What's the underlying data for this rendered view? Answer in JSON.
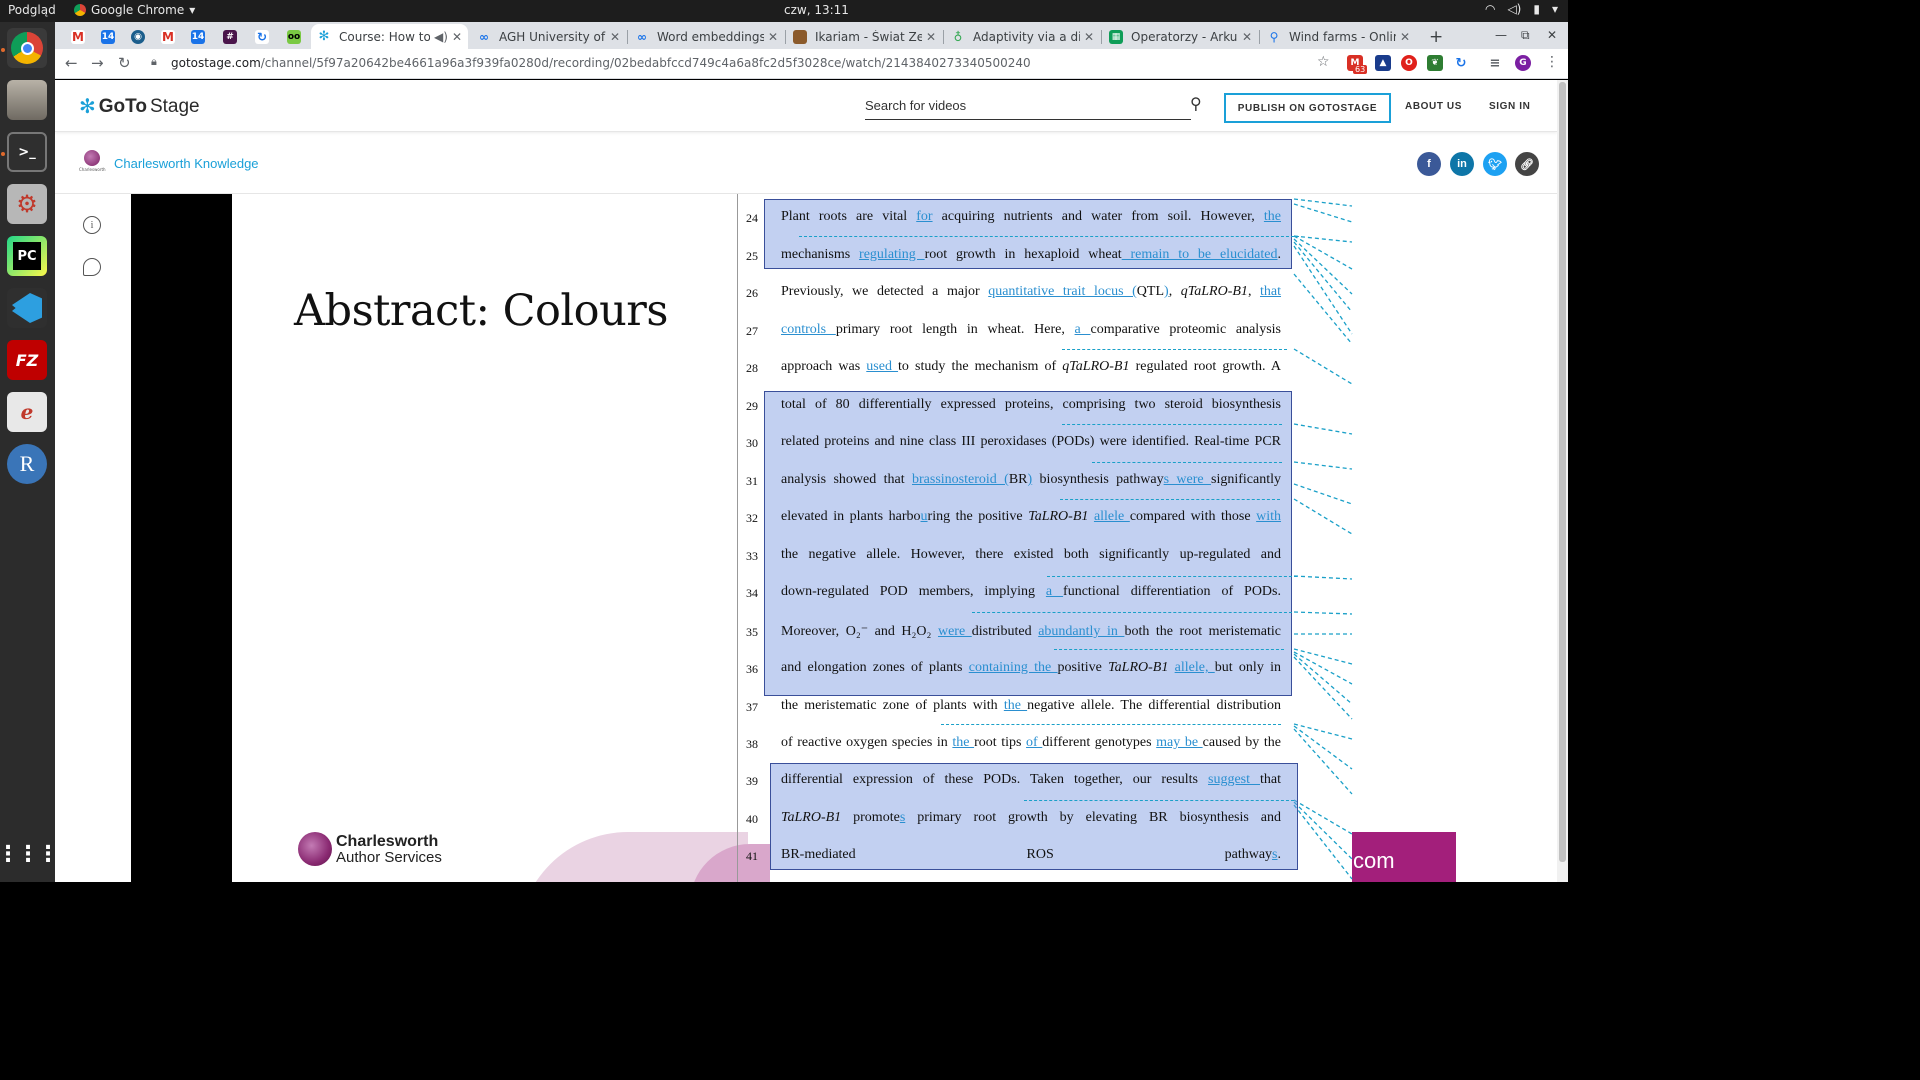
{
  "system_bar": {
    "left_label": "Podgląd",
    "app_name": "Google Chrome",
    "clock": "czw, 13:11"
  },
  "launcher": {
    "apps": [
      "chrome-icon",
      "files-icon",
      "terminal-icon",
      "settings-icon",
      "pycharm-icon",
      "vscode-icon",
      "filezilla-icon",
      "reader-icon",
      "r-icon",
      "app-grid-icon"
    ],
    "pycharm_label": "PC",
    "filezilla_label": "FZ",
    "r_label": "R"
  },
  "browser": {
    "tabs": [
      {
        "title": "Course: How to"
      },
      {
        "title": "AGH University of T"
      },
      {
        "title": "Word embeddings"
      },
      {
        "title": "Ikariam - Świat Zelo"
      },
      {
        "title": "Adaptivity via a dis"
      },
      {
        "title": "Operatorzy - Arkus"
      },
      {
        "title": "Wind farms - Onlin"
      }
    ],
    "url_host": "gotostage.com",
    "url_path": "/channel/5f97a20642be4661a96a3f939fa0280d/recording/02bedabfccd749c4a6a8fc2d5f3028ce/watch/2143840273340500240",
    "ext_badge": "63",
    "profile_initial": "G"
  },
  "site": {
    "logo_text_bold": "GoTo",
    "logo_text_rest": "Stage",
    "search_placeholder": "Search for videos",
    "publish_label": "PUBLISH ON GOTOSTAGE",
    "about_label": "ABOUT US",
    "signin_label": "SIGN IN",
    "channel_name": "Charlesworth Knowledge",
    "social": [
      "f",
      "in",
      "t",
      "link"
    ]
  },
  "slide": {
    "title": "Abstract: Colours",
    "brand_line1": "Charlesworth",
    "brand_line2": "Author Services",
    "corner_text": "com"
  },
  "manuscript": {
    "lines": [
      {
        "n": "24",
        "html": "Plant roots are vital <span class='u'>for</span> acquiring nutrients and water from soil. However, <span class='u'>the</span>"
      },
      {
        "n": "25",
        "html": "mechanisms <span class='u'>regulating </span>root growth in hexaploid wheat<span class='u'> remain to be elucidated</span>."
      },
      {
        "n": "26",
        "html": "Previously, we detected a major <span class='u'>quantitative trait locus (</span>QTL<span class='u'>)</span>, <i>qTaLRO-B1</i>, <span class='u'>that</span>"
      },
      {
        "n": "27",
        "html": "<span class='u'>controls </span>primary root length in wheat. Here, <span class='u'>a </span>comparative proteomic analysis"
      },
      {
        "n": "28",
        "html": "approach was <span class='u'>used </span>to study the mechanism of <i>qTaLRO-B1</i> regulated root growth. A"
      },
      {
        "n": "29",
        "html": "total of 80 differentially expressed proteins, comprising two steroid biosynthesis"
      },
      {
        "n": "30",
        "html": "related proteins and nine class III peroxidases (PODs) were identified. Real-time PCR"
      },
      {
        "n": "31",
        "html": "analysis showed that <span class='u'>brassinosteroid (</span>BR<span class='u'>)</span> biosynthesis pathway<span class='u'>s were </span>significantly"
      },
      {
        "n": "32",
        "html": "elevated in plants harbo<span class='u'>u</span>ring the positive <i>TaLRO-B1</i> <span class='u'>allele </span>compared with those <span class='u'>with</span>"
      },
      {
        "n": "33",
        "html": "the negative allele. However, there existed both significantly up-regulated and"
      },
      {
        "n": "34",
        "html": "down-regulated POD members, implying <span class='u'>a </span>functional differentiation of PODs."
      },
      {
        "n": "35",
        "html": "Moreover, O₂⁻ and H₂O₂ <span class='u'>were </span>distributed <span class='u'>abundantly in </span>both the root meristematic"
      },
      {
        "n": "36",
        "html": "and elongation zones of plants <span class='u'>containing the </span>positive <i>TaLRO-B1</i> <span class='u'>allele, </span>but only in"
      },
      {
        "n": "37",
        "html": "the meristematic zone of plants with <span class='u'>the </span>negative allele. The differential distribution"
      },
      {
        "n": "38",
        "html": "of reactive oxygen species in <span class='u'>the </span>root tips <span class='u'>of </span>different genotypes <span class='u'>may be </span>caused by the"
      },
      {
        "n": "39",
        "html": "differential expression of these PODs. Taken together, our results <span class='u'>suggest </span>that"
      },
      {
        "n": "40",
        "html": "<i>TaLRO-B1</i> promote<span class='u'>s</span> primary root growth by elevating BR biosynthesis and"
      },
      {
        "n": "41",
        "html": "BR-mediated ROS pathway<span class='u'>s</span>."
      }
    ]
  },
  "colors": {
    "accent": "#1aa0d8",
    "highlight_fill": "#8fa6e0",
    "highlight_border": "#3a4f9a",
    "slide_magenta": "#a31f7b"
  }
}
